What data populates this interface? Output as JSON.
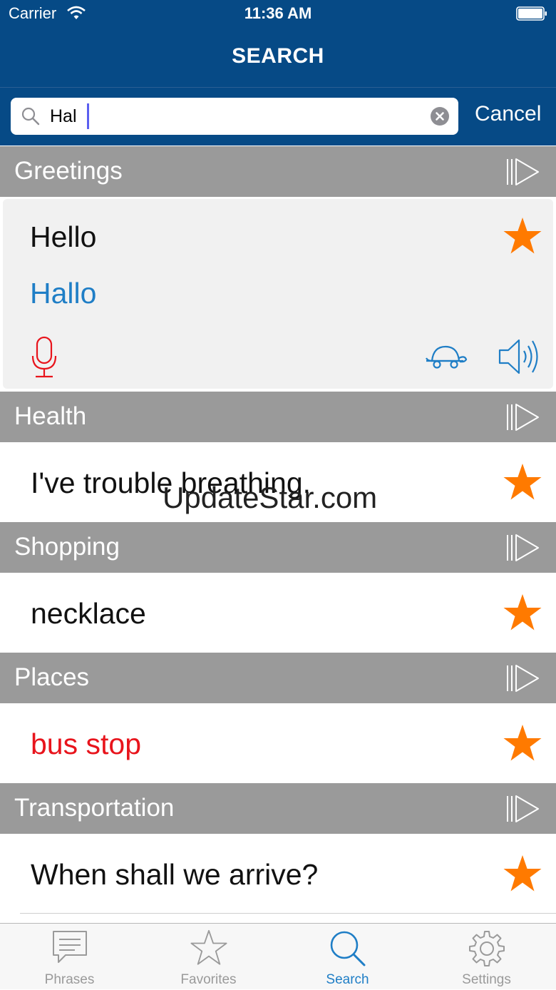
{
  "status": {
    "carrier": "Carrier",
    "time": "11:36 AM"
  },
  "nav": {
    "title": "SEARCH"
  },
  "search": {
    "query": "Hal",
    "cancel_label": "Cancel"
  },
  "colors": {
    "nav_bg": "#064a86",
    "section_bg": "#9a9a9a",
    "accent_blue": "#1f7ec6",
    "star_orange": "#ff7a00",
    "mic_red": "#e8141c"
  },
  "sections": [
    {
      "label": "Greetings",
      "phrase": "Hello",
      "translation": "Hallo",
      "favorited": true,
      "expanded": true
    },
    {
      "label": "Health",
      "phrase": "I've trouble breathing.",
      "favorited": true
    },
    {
      "label": "Shopping",
      "phrase": "necklace",
      "favorited": true
    },
    {
      "label": "Places",
      "phrase": "bus stop",
      "favorited": true,
      "highlighted": true
    },
    {
      "label": "Transportation",
      "phrase": "When shall we arrive?",
      "favorited": true
    }
  ],
  "watermark": "UpdateStar.com",
  "tabs": [
    {
      "label": "Phrases",
      "icon": "speech-bubble-icon"
    },
    {
      "label": "Favorites",
      "icon": "star-outline-icon"
    },
    {
      "label": "Search",
      "icon": "search-icon",
      "active": true
    },
    {
      "label": "Settings",
      "icon": "gear-icon"
    }
  ]
}
